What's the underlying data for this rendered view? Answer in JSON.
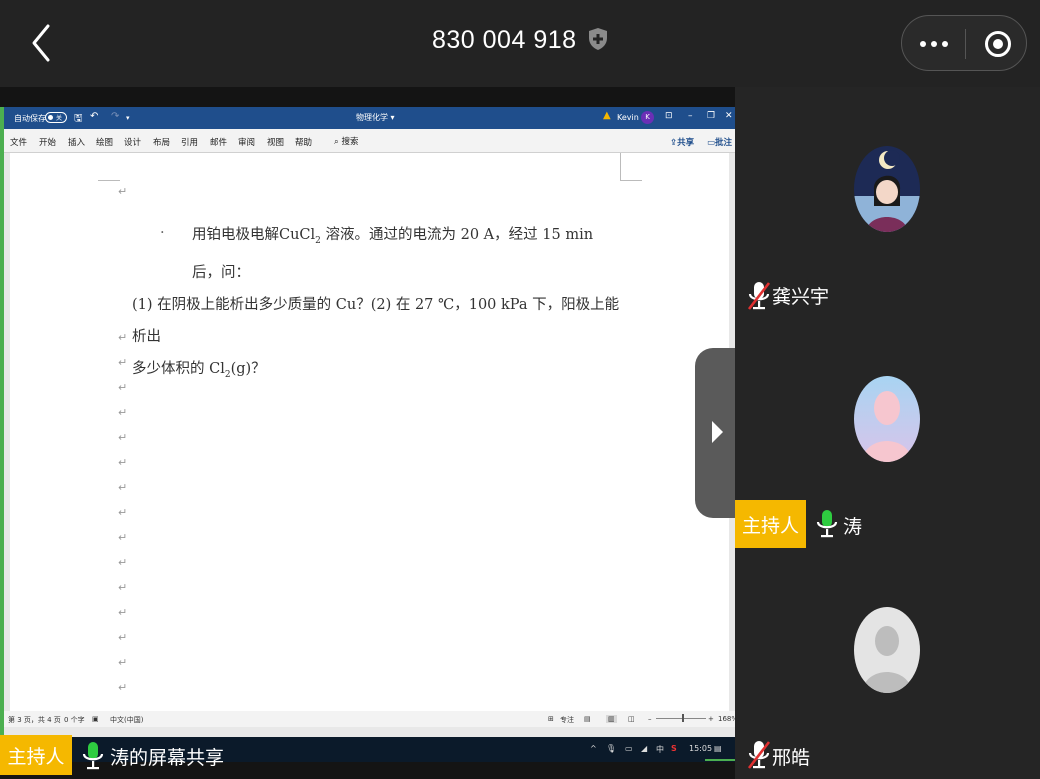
{
  "header": {
    "meeting_id": "830 004 918"
  },
  "word": {
    "autosave_label": "自动保存",
    "autosave_state": "关",
    "doc_name": "物理化学 ▾",
    "user_name": "Kevin",
    "user_initial": "K",
    "ribbon_tabs": [
      "文件",
      "开始",
      "插入",
      "绘图",
      "设计",
      "布局",
      "引用",
      "邮件",
      "审阅",
      "视图",
      "帮助"
    ],
    "search_label": "搜索",
    "share_label": "共享",
    "comment_label": "批注",
    "problem_line1": "用铂电极电解CuCl",
    "problem_line1_sub": "2",
    "problem_line1_rest": " 溶液。通过的电流为 20 A，经过 15 min 后，问：",
    "problem_line2": "(1) 在阴极上能析出多少质量的 Cu？(2) 在 27 ℃，100 kPa 下，阳极上能析出",
    "problem_line3_a": "多少体积的 Cl",
    "problem_line3_sub": "2",
    "problem_line3_b": "(g)？",
    "bullet": "·",
    "para_mark": "↵",
    "status": {
      "page": "第 3 页，共 4 页",
      "words": "0 个字",
      "language": "中文(中国)",
      "focus": "专注",
      "zoom": "168%"
    }
  },
  "taskbar": {
    "ime": "中",
    "time": "15:05"
  },
  "share_label": {
    "host": "主持人",
    "text": "涛的屏幕共享"
  },
  "participants": [
    {
      "name": "龚兴宇",
      "muted": true,
      "host": false
    },
    {
      "name": "涛",
      "muted": false,
      "host": true,
      "host_label": "主持人"
    },
    {
      "name": "邢皓",
      "muted": true,
      "host": false
    }
  ],
  "colors": {
    "host_tag": "#f5b800",
    "mic_active": "#2ecc40",
    "word_title": "#1f4e8c"
  }
}
